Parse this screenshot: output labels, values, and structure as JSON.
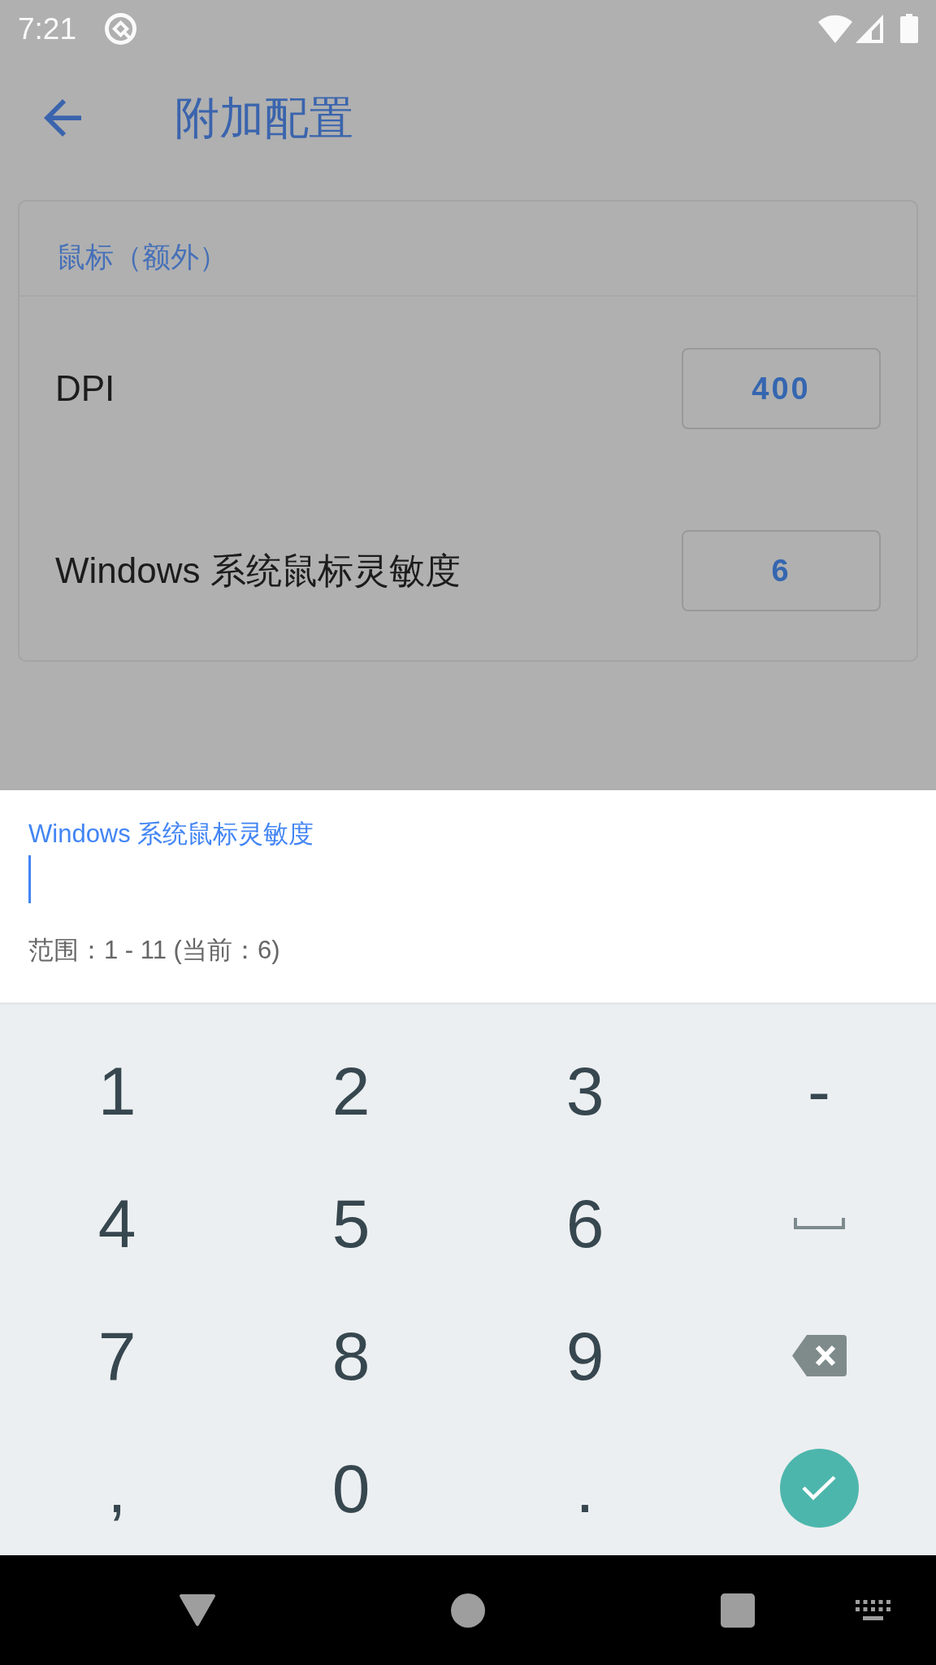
{
  "status_bar": {
    "time": "7:21"
  },
  "app_bar": {
    "title": "附加配置"
  },
  "card": {
    "title": "鼠标（额外）",
    "rows": [
      {
        "label": "DPI",
        "value": "400"
      },
      {
        "label": "Windows 系统鼠标灵敏度",
        "value": "6"
      }
    ]
  },
  "input_sheet": {
    "label": "Windows 系统鼠标灵敏度",
    "focused": true,
    "hint": "范围：1 - 11 (当前：6)"
  },
  "keyboard": {
    "keys": [
      {
        "kind": "char",
        "label": "1"
      },
      {
        "kind": "char",
        "label": "2"
      },
      {
        "kind": "char",
        "label": "3"
      },
      {
        "kind": "char",
        "label": "-"
      },
      {
        "kind": "char",
        "label": "4"
      },
      {
        "kind": "char",
        "label": "5"
      },
      {
        "kind": "char",
        "label": "6"
      },
      {
        "kind": "space"
      },
      {
        "kind": "char",
        "label": "7"
      },
      {
        "kind": "char",
        "label": "8"
      },
      {
        "kind": "char",
        "label": "9"
      },
      {
        "kind": "backspace"
      },
      {
        "kind": "char",
        "label": ","
      },
      {
        "kind": "char",
        "label": "0"
      },
      {
        "kind": "char",
        "label": "."
      },
      {
        "kind": "done"
      }
    ]
  }
}
